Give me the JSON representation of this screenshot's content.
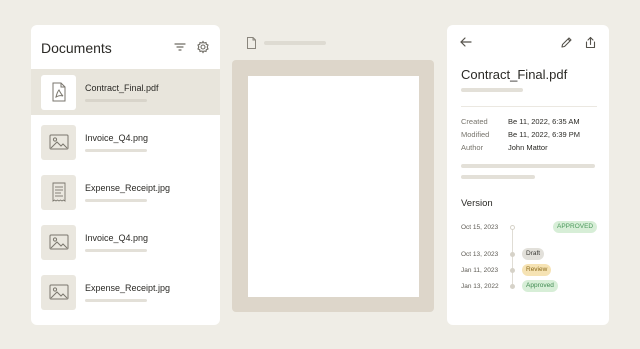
{
  "left_panel": {
    "title": "Documents",
    "documents": [
      {
        "name": "Contract_Final.pdf",
        "icon": "pdf-file-icon",
        "active": true
      },
      {
        "name": "Invoice_Q4.png",
        "icon": "image-icon",
        "active": false
      },
      {
        "name": "Expense_Receipt.jpg",
        "icon": "receipt-icon",
        "active": false
      },
      {
        "name": "Invoice_Q4.png",
        "icon": "image-icon",
        "active": false
      },
      {
        "name": "Expense_Receipt.jpg",
        "icon": "image-icon",
        "active": false
      }
    ]
  },
  "details": {
    "title": "Contract_Final.pdf",
    "meta": [
      {
        "label": "Created",
        "value": "Be 11, 2022, 6:35 AM"
      },
      {
        "label": "Modified",
        "value": "Be 11, 2022, 6:39 PM"
      },
      {
        "label": "Author",
        "value": "John Mattor"
      }
    ],
    "version_heading": "Version",
    "versions": [
      {
        "date": "Oct 15, 2023",
        "status": "APPROVED",
        "color": "#4c9a5c",
        "bg": "#d7eed7"
      },
      {
        "date": "Oct 13, 2023",
        "status": "Draft",
        "color": "#3b3a36",
        "bg": "#e2e0da"
      },
      {
        "date": "Jan 11, 2023",
        "status": "Review",
        "color": "#8a6a1d",
        "bg": "#f6e3b4"
      },
      {
        "date": "Jan 13, 2022",
        "status": "Approved",
        "color": "#3f8a50",
        "bg": "#d7eed7"
      }
    ]
  },
  "colors": {
    "background": "#efede6",
    "panel": "#ffffff",
    "active_row": "#e8e5dc",
    "preview_frame": "#ddd6ca"
  }
}
